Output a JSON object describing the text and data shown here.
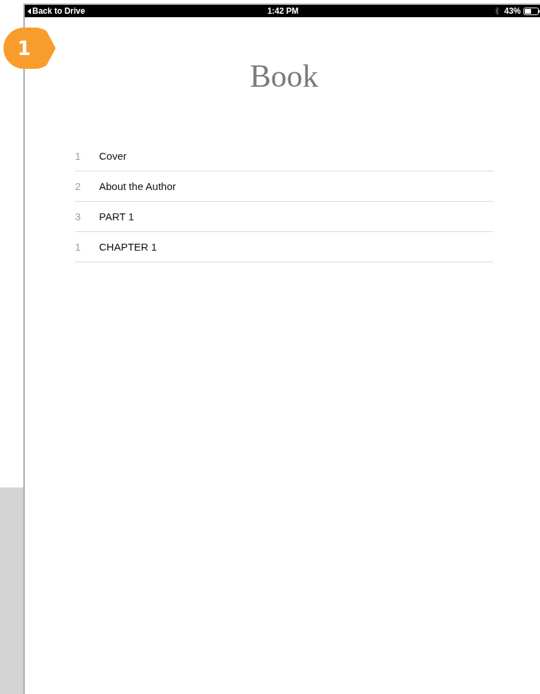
{
  "status_bar": {
    "back_label": "Back to Drive",
    "time": "1:42 PM",
    "battery": "43%"
  },
  "callout": {
    "number": "1"
  },
  "title": "Book",
  "contents": [
    {
      "number": "1",
      "title": "Cover"
    },
    {
      "number": "2",
      "title": "About the Author"
    },
    {
      "number": "3",
      "title": "PART 1"
    },
    {
      "number": "1",
      "title": "CHAPTER 1"
    }
  ]
}
